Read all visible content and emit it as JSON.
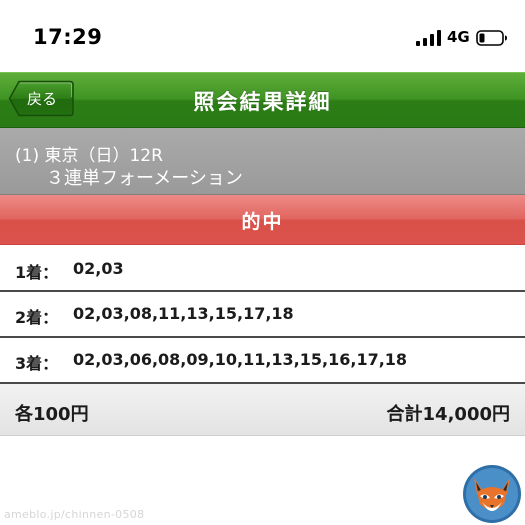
{
  "status_bar": {
    "time": "17:29",
    "network": "4G",
    "signal_icon": "cellular-signal-icon",
    "battery_icon": "battery-low-icon"
  },
  "header": {
    "back_label": "戻る",
    "title": "照会結果詳細",
    "color": "#3f9423"
  },
  "race": {
    "name": "(1) 東京（日）12R",
    "bet_type": "３連単フォーメーション",
    "color": "#a2a3a2"
  },
  "result": {
    "label": "的中",
    "color": "#e05d57"
  },
  "placements": [
    {
      "label": "1着：",
      "numbers": "02,03"
    },
    {
      "label": "2着：",
      "numbers": "02,03,08,11,13,15,17,18"
    },
    {
      "label": "3着：",
      "numbers": "02,03,06,08,09,10,11,13,15,16,17,18"
    }
  ],
  "totals": {
    "unit_price": "各100円",
    "total": "合計14,000円"
  },
  "watermark": {
    "text": "ameblo.jp/chinnen-0508"
  },
  "mascot": {
    "icon": "fox-mascot-icon"
  }
}
